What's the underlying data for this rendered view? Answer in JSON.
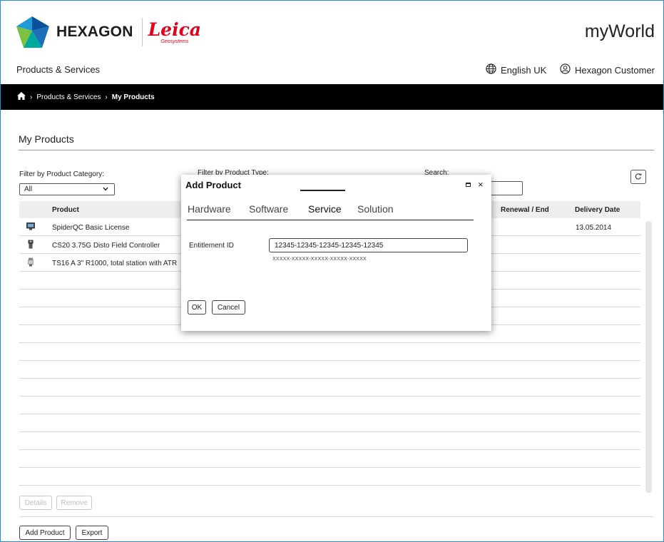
{
  "header": {
    "brand": "HEXAGON",
    "partner_script": "Leica",
    "partner_sub": "Geosystems",
    "app_name": "myWorld",
    "section": "Products & Services",
    "language": "English UK",
    "user": "Hexagon Customer"
  },
  "breadcrumb": {
    "items": [
      "Products & Services",
      "My Products"
    ]
  },
  "page": {
    "title": "My Products"
  },
  "filters": {
    "category_label": "Filter by Product Category:",
    "category_value": "All",
    "type_label": "Filter by Product Type:",
    "search_label": "Search:"
  },
  "table": {
    "columns": [
      "Product",
      "Renewal / End",
      "Delivery Date"
    ],
    "rows": [
      {
        "name": "SpiderQC Basic License",
        "date": "13.05.2014",
        "icon": "monitor-icon"
      },
      {
        "name": "CS20 3.75G Disto Field Controller",
        "date": "",
        "icon": "controller-icon"
      },
      {
        "name": "TS16 A 3\" R1000, total station with ATR",
        "date": "",
        "icon": "total-station-icon"
      }
    ]
  },
  "buttons": {
    "details": "Details",
    "remove": "Remove",
    "add_product": "Add Product",
    "export": "Export"
  },
  "modal": {
    "title": "Add Product",
    "tabs": [
      "Hardware",
      "Software",
      "Service",
      "Solution"
    ],
    "active_tab": "Service",
    "field_label": "Entitlement ID",
    "field_value": "12345-12345-12345-12345-12345",
    "field_hint": "XXXXX-XXXXX-XXXXX-XXXXX-XXXXX",
    "ok": "OK",
    "cancel": "Cancel"
  },
  "colors": {
    "frame_border": "#2e8bc9",
    "leica_red": "#e2001a",
    "breadcrumb_bg": "#000000"
  }
}
